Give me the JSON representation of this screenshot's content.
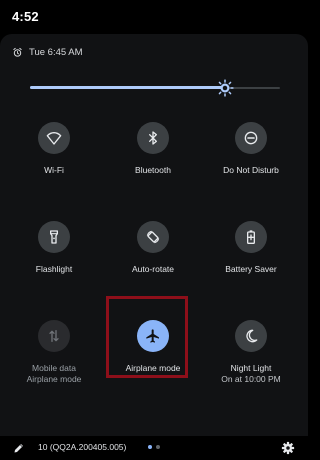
{
  "status_bar": {
    "time": "4:52"
  },
  "header": {
    "alarm_text": "Tue 6:45 AM"
  },
  "brightness": {
    "level": 0.78
  },
  "tiles": [
    {
      "key": "wifi",
      "label": "Wi-Fi",
      "sub": "",
      "icon": "wifi-icon",
      "state": "off"
    },
    {
      "key": "bluetooth",
      "label": "Bluetooth",
      "sub": "",
      "icon": "bluetooth-icon",
      "state": "off"
    },
    {
      "key": "dnd",
      "label": "Do Not Disturb",
      "sub": "",
      "icon": "do-not-disturb-icon",
      "state": "off"
    },
    {
      "key": "flashlight",
      "label": "Flashlight",
      "sub": "",
      "icon": "flashlight-icon",
      "state": "off"
    },
    {
      "key": "autorotate",
      "label": "Auto-rotate",
      "sub": "",
      "icon": "auto-rotate-icon",
      "state": "off"
    },
    {
      "key": "batterysaver",
      "label": "Battery Saver",
      "sub": "",
      "icon": "battery-saver-icon",
      "state": "off"
    },
    {
      "key": "mobiledata",
      "label": "Mobile data",
      "sub": "Airplane mode",
      "icon": "mobile-data-icon",
      "state": "disabled"
    },
    {
      "key": "airplane",
      "label": "Airplane mode",
      "sub": "",
      "icon": "airplane-icon",
      "state": "on"
    },
    {
      "key": "nightlight",
      "label": "Night Light",
      "sub": "On at 10:00 PM",
      "icon": "night-light-icon",
      "state": "off"
    }
  ],
  "footer": {
    "build": "10 (QQ2A.200405.005)",
    "page_count": 2,
    "active_page": 0
  },
  "colors": {
    "accent": "#8ab4f8",
    "tile_off": "#3c4043",
    "panel": "#111214",
    "highlight_box": "#8e0f1a"
  }
}
